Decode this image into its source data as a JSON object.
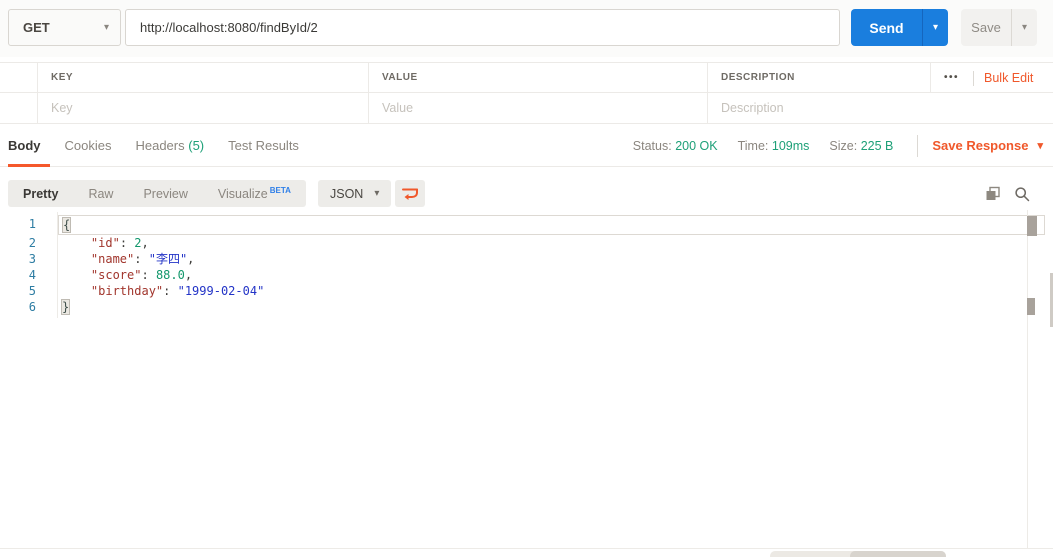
{
  "request": {
    "method": "GET",
    "url": "http://localhost:8080/findById/2",
    "send": "Send",
    "save": "Save"
  },
  "params": {
    "key_header": "KEY",
    "value_header": "VALUE",
    "description_header": "DESCRIPTION",
    "key_placeholder": "Key",
    "value_placeholder": "Value",
    "description_placeholder": "Description",
    "bulk_edit": "Bulk Edit"
  },
  "response": {
    "tabs": {
      "body": "Body",
      "cookies": "Cookies",
      "headers": "Headers",
      "headers_count": "(5)",
      "test_results": "Test Results"
    },
    "status_label": "Status:",
    "status_value": "200 OK",
    "time_label": "Time:",
    "time_value": "109ms",
    "size_label": "Size:",
    "size_value": "225 B",
    "save_response": "Save Response"
  },
  "viewer": {
    "pretty": "Pretty",
    "raw": "Raw",
    "preview": "Preview",
    "visualize": "Visualize",
    "beta": "BETA",
    "format": "JSON"
  },
  "code": {
    "lines": [
      {
        "num": 1,
        "tokens": [
          {
            "t": "{",
            "c": "brace"
          }
        ]
      },
      {
        "num": 2,
        "tokens": [
          {
            "t": "    ",
            "c": "plain"
          },
          {
            "t": "\"id\"",
            "c": "key"
          },
          {
            "t": ": ",
            "c": "plain"
          },
          {
            "t": "2",
            "c": "num"
          },
          {
            "t": ",",
            "c": "plain"
          }
        ]
      },
      {
        "num": 3,
        "tokens": [
          {
            "t": "    ",
            "c": "plain"
          },
          {
            "t": "\"name\"",
            "c": "key"
          },
          {
            "t": ": ",
            "c": "plain"
          },
          {
            "t": "\"李四\"",
            "c": "str"
          },
          {
            "t": ",",
            "c": "plain"
          }
        ]
      },
      {
        "num": 4,
        "tokens": [
          {
            "t": "    ",
            "c": "plain"
          },
          {
            "t": "\"score\"",
            "c": "key"
          },
          {
            "t": ": ",
            "c": "plain"
          },
          {
            "t": "88.0",
            "c": "num"
          },
          {
            "t": ",",
            "c": "plain"
          }
        ]
      },
      {
        "num": 5,
        "tokens": [
          {
            "t": "    ",
            "c": "plain"
          },
          {
            "t": "\"birthday\"",
            "c": "key"
          },
          {
            "t": ": ",
            "c": "plain"
          },
          {
            "t": "\"1999-02-04\"",
            "c": "str"
          }
        ]
      },
      {
        "num": 6,
        "tokens": [
          {
            "t": "}",
            "c": "brace"
          }
        ]
      }
    ]
  },
  "icons": {
    "chevron_down": "▾",
    "more_options": "•••"
  },
  "colors": {
    "accent_orange": "#F0582B",
    "send_blue": "#1A7EDE",
    "status_green": "#1EA078",
    "beta_blue": "#2F7FE8",
    "key_token": "#A1352C",
    "string_token": "#2334C7",
    "number_token": "#12976B",
    "line_number": "#2E7DA3"
  }
}
